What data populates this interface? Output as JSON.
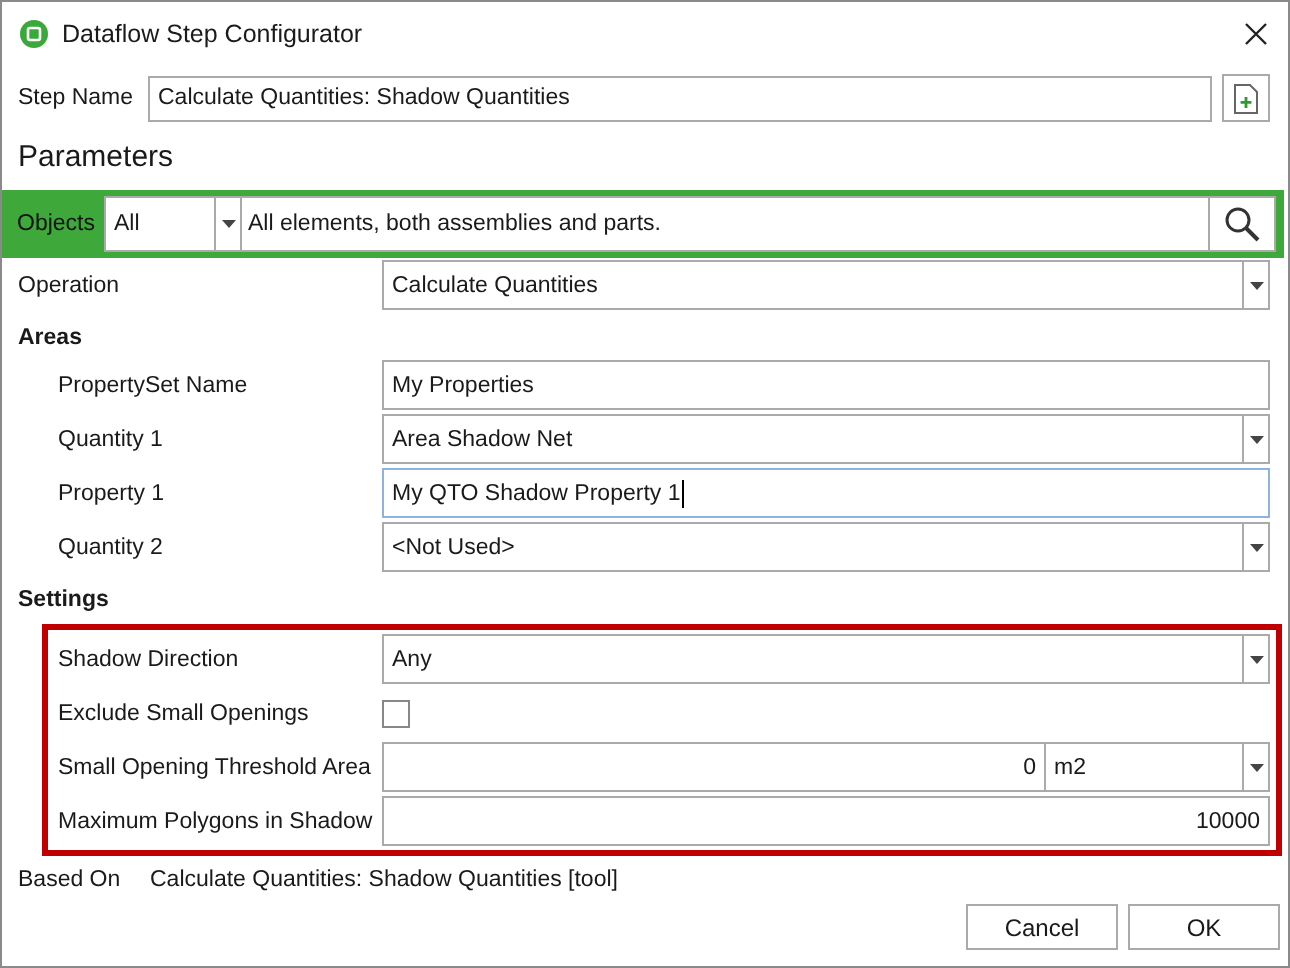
{
  "window": {
    "title": "Dataflow Step Configurator"
  },
  "step_name": {
    "label": "Step Name",
    "value": "Calculate Quantities: Shadow Quantities"
  },
  "parameters_heading": "Parameters",
  "objects": {
    "label": "Objects",
    "filter": "All",
    "description": "All elements, both assemblies and parts."
  },
  "operation": {
    "label": "Operation",
    "value": "Calculate Quantities"
  },
  "sections": [
    {
      "title": "Areas",
      "highlighted": false,
      "rows": [
        {
          "kind": "text",
          "label": "PropertySet Name",
          "value": "My Properties",
          "focused": false
        },
        {
          "kind": "dropdown",
          "label": "Quantity 1",
          "value": "Area Shadow Net"
        },
        {
          "kind": "text",
          "label": "Property 1",
          "value": "My QTO Shadow Property 1",
          "focused": true
        },
        {
          "kind": "dropdown",
          "label": "Quantity 2",
          "value": "<Not Used>"
        }
      ]
    },
    {
      "title": "Settings",
      "highlighted": true,
      "rows": [
        {
          "kind": "dropdown",
          "label": "Shadow Direction",
          "value": "Any"
        },
        {
          "kind": "checkbox",
          "label": "Exclude Small Openings",
          "checked": false
        },
        {
          "kind": "number-unit",
          "label": "Small Opening Threshold Area",
          "value": "0",
          "unit": "m2"
        },
        {
          "kind": "number",
          "label": "Maximum Polygons in Shadow",
          "value": "10000"
        }
      ]
    }
  ],
  "based_on": {
    "label": "Based On",
    "value": "Calculate Quantities: Shadow Quantities [tool]"
  },
  "buttons": [
    "Cancel",
    "OK"
  ]
}
